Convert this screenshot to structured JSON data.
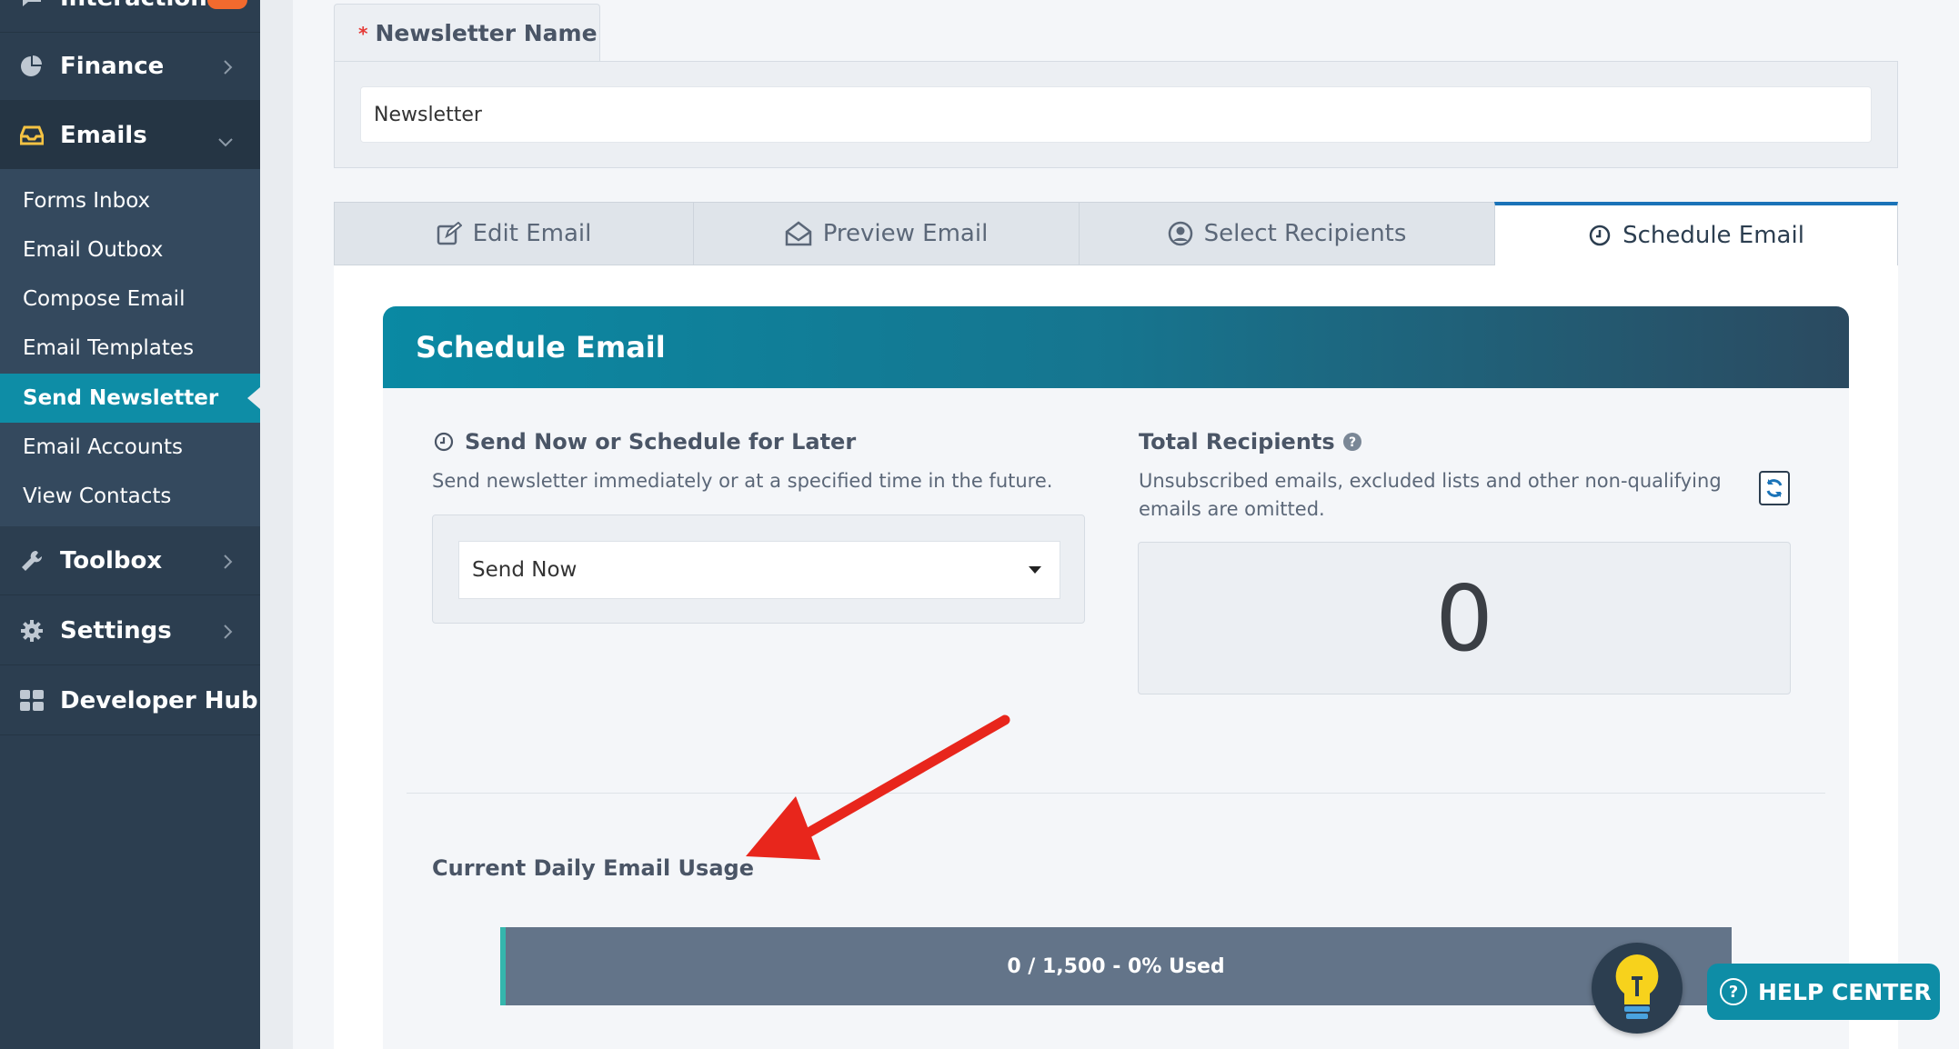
{
  "sidebar": {
    "top_partial_label": "Interactions",
    "items": [
      {
        "label": "Finance",
        "icon": "pie-chart-icon"
      },
      {
        "label": "Emails",
        "icon": "inbox-icon"
      },
      {
        "label": "Toolbox",
        "icon": "wrench-icon"
      },
      {
        "label": "Settings",
        "icon": "gear-icon"
      },
      {
        "label": "Developer Hub",
        "icon": "grid-icon"
      }
    ],
    "email_submenu": [
      {
        "label": "Forms Inbox"
      },
      {
        "label": "Email Outbox"
      },
      {
        "label": "Compose Email"
      },
      {
        "label": "Email Templates"
      },
      {
        "label": "Send Newsletter",
        "active": true
      },
      {
        "label": "Email Accounts"
      },
      {
        "label": "View Contacts"
      }
    ]
  },
  "newsletter": {
    "tab_label": "Newsletter Name",
    "required_mark": "*",
    "value": "Newsletter"
  },
  "tabs": [
    {
      "label": "Edit Email",
      "icon": "edit-icon"
    },
    {
      "label": "Preview Email",
      "icon": "envelope-open-icon"
    },
    {
      "label": "Select Recipients",
      "icon": "user-circle-icon"
    },
    {
      "label": "Schedule Email",
      "icon": "clock-icon",
      "active": true
    }
  ],
  "schedule": {
    "header": "Schedule Email",
    "send_title": "Send Now or Schedule for Later",
    "send_desc": "Send newsletter immediately or at a specified time in the future.",
    "send_option": "Send Now",
    "recipients_title": "Total Recipients",
    "recipients_desc": "Unsubscribed emails, excluded lists and other non-qualifying emails are omitted.",
    "recipients_count": "0",
    "usage_title": "Current Daily Email Usage",
    "usage_text": "0 / 1,500 - 0% Used",
    "usage_fraction": 0
  },
  "help": {
    "label": "HELP CENTER"
  },
  "colors": {
    "accent": "#0e8da6",
    "sidebar": "#2c3e50",
    "annotation_arrow": "#e8261c",
    "active_tab_border": "#1a73b8"
  }
}
